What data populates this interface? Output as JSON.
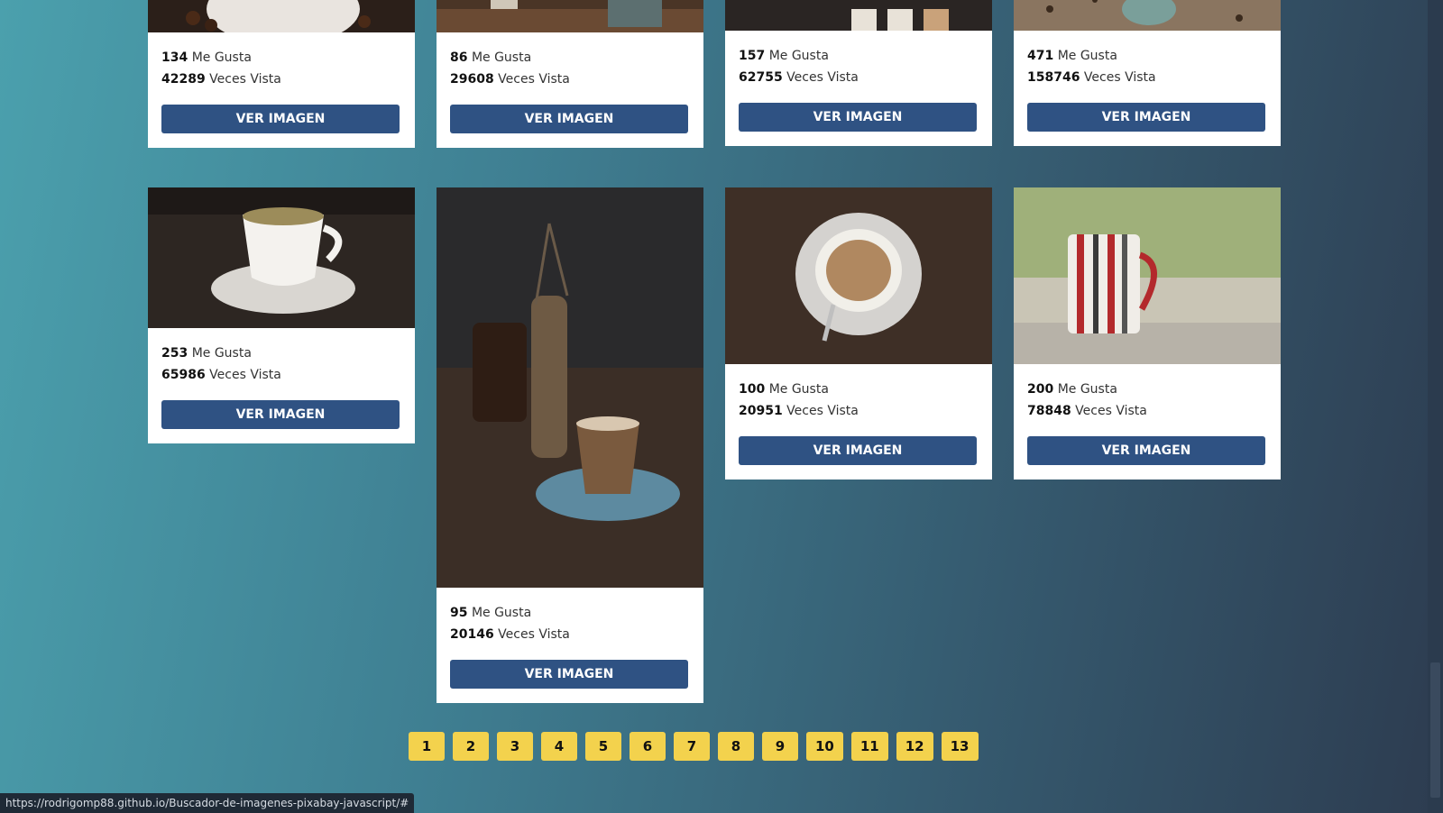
{
  "labels": {
    "likes": "Me Gusta",
    "views": "Veces Vista",
    "button": "VER IMAGEN"
  },
  "cards": [
    {
      "likes": "134",
      "views": "42289"
    },
    {
      "likes": "86",
      "views": "29608"
    },
    {
      "likes": "157",
      "views": "62755"
    },
    {
      "likes": "471",
      "views": "158746"
    },
    {
      "likes": "253",
      "views": "65986"
    },
    {
      "likes": "95",
      "views": "20146"
    },
    {
      "likes": "100",
      "views": "20951"
    },
    {
      "likes": "200",
      "views": "78848"
    }
  ],
  "pagination": [
    "1",
    "2",
    "3",
    "4",
    "5",
    "6",
    "7",
    "8",
    "9",
    "10",
    "11",
    "12",
    "13"
  ],
  "status_url": "https://rodrigomp88.github.io/Buscador-de-imagenes-pixabay-javascript/#",
  "colors": {
    "button": "#2f5283",
    "page_button": "#f3d24d"
  }
}
